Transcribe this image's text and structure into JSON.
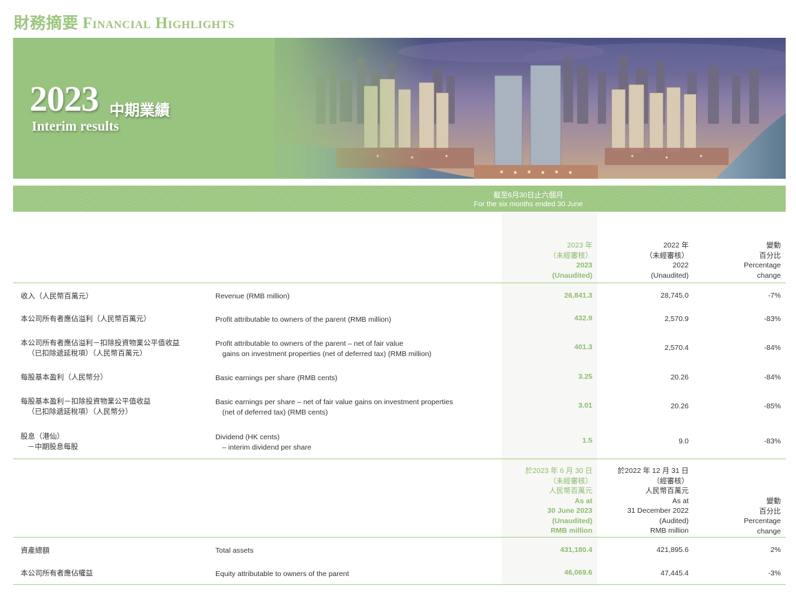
{
  "section_title": {
    "zh": "財務摘要",
    "en": "Financial Highlights"
  },
  "banner": {
    "year": "2023",
    "title_zh": "中期業績",
    "title_en": "Interim results"
  },
  "colors": {
    "accent_green": "#9cc67f",
    "highlight_green": "#8cbd6d"
  },
  "period": {
    "zh": "截至6月30日止六個月",
    "en": "For the six months ended 30 June"
  },
  "headers": {
    "col2023": [
      "2023 年",
      "（未經審核）",
      "2023",
      "(Unaudited)"
    ],
    "col2022": [
      "2022 年",
      "（未經審核）",
      "2022",
      "(Unaudited)"
    ],
    "colpc": [
      "變動",
      "百分比",
      "Percentage",
      "change"
    ]
  },
  "rows": [
    {
      "zh": [
        "收入（人民幣百萬元）"
      ],
      "en": [
        "Revenue (RMB million)"
      ],
      "v2023": "26,841.3",
      "v2022": "28,745.0",
      "pc": "-7%"
    },
    {
      "zh": [
        "本公司所有者應佔溢利（人民幣百萬元）"
      ],
      "en": [
        "Profit attributable to owners of the parent (RMB million)"
      ],
      "v2023": "432.9",
      "v2022": "2,570.9",
      "pc": "-83%"
    },
    {
      "zh": [
        "本公司所有者應佔溢利－扣除投資物業公平值收益",
        "（已扣除遞延稅項）（人民幣百萬元）"
      ],
      "en": [
        "Profit attributable to owners of the parent – net of fair value",
        "gains on investment properties (net of deferred tax) (RMB million)"
      ],
      "v2023": "401.3",
      "v2022": "2,570.4",
      "pc": "-84%"
    },
    {
      "zh": [
        "每股基本盈利（人民幣分）"
      ],
      "en": [
        "Basic earnings per share (RMB cents)"
      ],
      "v2023": "3.25",
      "v2022": "20.26",
      "pc": "-84%"
    },
    {
      "zh": [
        "每股基本盈利－扣除投資物業公平值收益",
        "（已扣除遞延稅項）（人民幣分）"
      ],
      "en": [
        "Basic earnings per share – net of fair value gains on investment properties",
        "(net of deferred tax) (RMB cents)"
      ],
      "v2023": "3.01",
      "v2022": "20.26",
      "pc": "-85%"
    },
    {
      "zh": [
        "股息（港仙）",
        "－中期股息每股"
      ],
      "en": [
        "Dividend (HK cents)",
        "– interim dividend per share"
      ],
      "v2023": "1.5",
      "v2022": "9.0",
      "pc": "-83%"
    }
  ],
  "balance_headers": {
    "col2023": [
      "於2023 年 6 月 30 日",
      "（未經審核）",
      "人民幣百萬元",
      "As at",
      "30 June 2023",
      "(Unaudited)",
      "RMB million"
    ],
    "col2022": [
      "於2022 年 12 月 31 日",
      "（經審核）",
      "人民幣百萬元",
      "As at",
      "31 December 2022",
      "(Audited)",
      "RMB million"
    ],
    "colpc": [
      "變動",
      "百分比",
      "Percentage",
      "change"
    ]
  },
  "balance_rows": [
    {
      "zh": "資產總額",
      "en": "Total assets",
      "v2023": "431,180.4",
      "v2022": "421,895.6",
      "pc": "2%"
    },
    {
      "zh": "本公司所有者應佔權益",
      "en": "Equity attributable to owners of the parent",
      "v2023": "46,069.6",
      "v2022": "47,445.4",
      "pc": "-3%"
    }
  ]
}
